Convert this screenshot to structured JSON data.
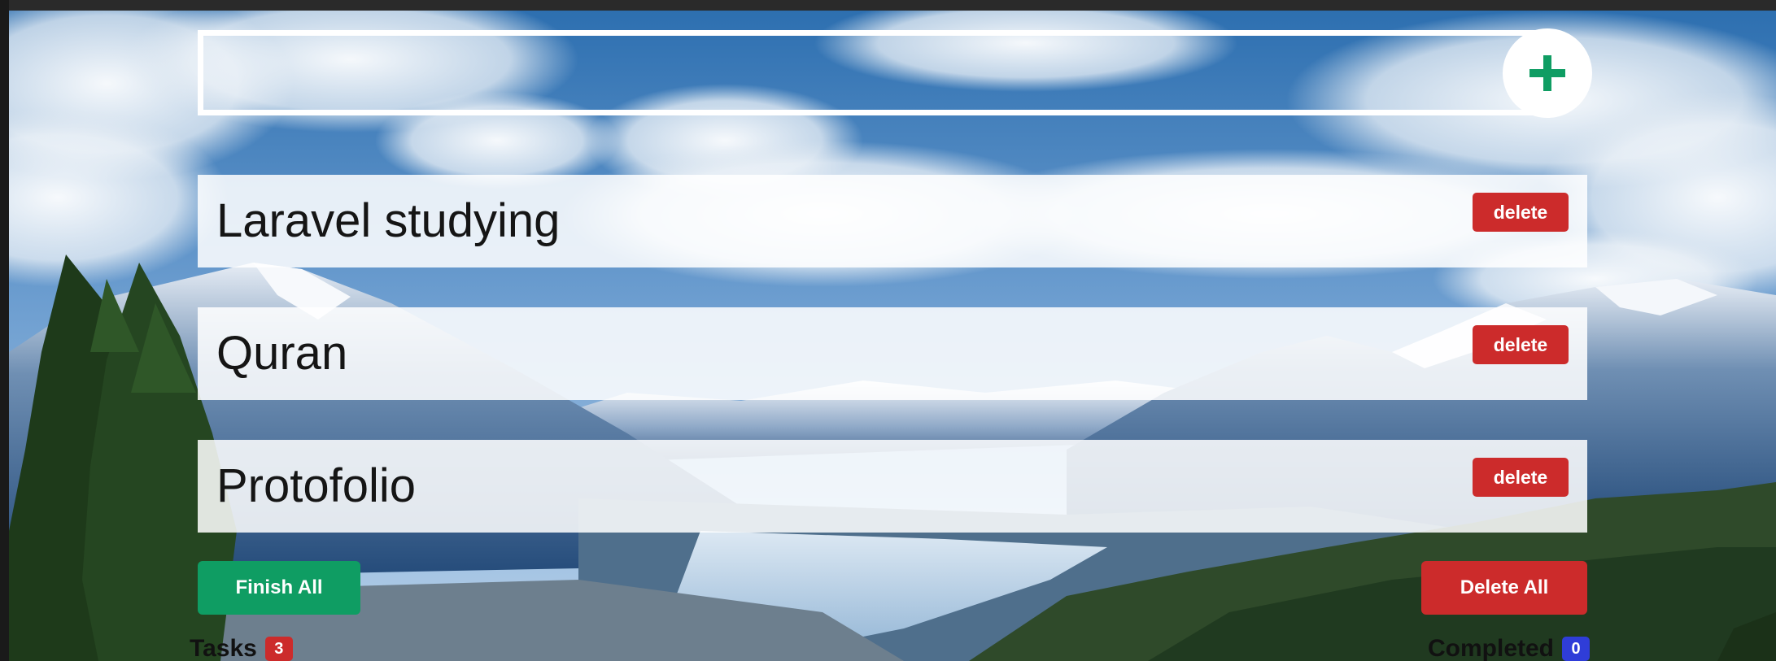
{
  "add_task": {
    "input_value": "",
    "input_placeholder": "",
    "button_icon": "plus-icon"
  },
  "tasks": [
    {
      "text": "Laravel studying",
      "delete_label": "delete"
    },
    {
      "text": "Quran",
      "delete_label": "delete"
    },
    {
      "text": "Protofolio",
      "delete_label": "delete"
    }
  ],
  "actions": {
    "finish_all_label": "Finish All",
    "delete_all_label": "Delete All"
  },
  "counters": {
    "tasks_label": "Tasks",
    "tasks_count": "3",
    "completed_label": "Completed",
    "completed_count": "0"
  },
  "colors": {
    "accent_green": "#0f9d63",
    "danger_red": "#cc2b2b",
    "completed_blue": "#2f3dd8"
  }
}
